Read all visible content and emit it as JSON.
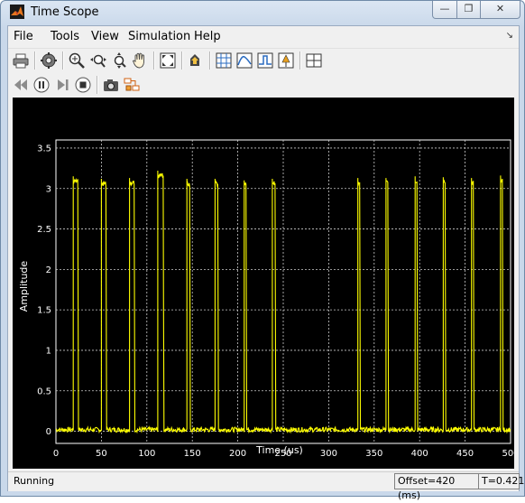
{
  "window": {
    "title": "Time Scope",
    "minimize_glyph": "—",
    "restore_glyph": "❐",
    "close_glyph": "✕"
  },
  "menu": {
    "items": [
      "File",
      "Tools",
      "View",
      "Simulation",
      "Help"
    ],
    "overflow_glyph": "↘"
  },
  "toolbar1": {
    "icons": [
      "print-icon",
      "settings-icon",
      "zoom-in-icon",
      "zoom-x-icon",
      "zoom-y-icon",
      "pan-hand-icon",
      "autoscale-icon",
      "restore-axes-icon",
      "data-cursors-icon",
      "peak-finder-icon",
      "bilevel-measurements-icon",
      "signal-statistics-icon",
      "layout-icon"
    ]
  },
  "toolbar2": {
    "icons": [
      "step-back-icon",
      "pause-icon",
      "step-forward-icon",
      "stop-icon",
      "snapshot-camera-icon",
      "highlight-block-icon"
    ]
  },
  "status": {
    "state": "Running",
    "offset": "Offset=420 (ms)",
    "time": "T=0.421"
  },
  "colors": {
    "plot_background": "#000000",
    "signal": "#ffff00",
    "grid": "#ffffff",
    "axes_text": "#ffffff"
  },
  "chart_data": {
    "type": "line",
    "title": "",
    "xlabel": "Time (us)",
    "ylabel": "Amplitude",
    "xlim": [
      0,
      500
    ],
    "ylim": [
      -0.15,
      3.6
    ],
    "xticks": [
      0,
      50,
      100,
      150,
      200,
      250,
      300,
      350,
      400,
      450,
      500
    ],
    "yticks": [
      0,
      0.5,
      1,
      1.5,
      2,
      2.5,
      3,
      3.5
    ],
    "grid": true,
    "legend": "none",
    "series": [
      {
        "color": "#ffff00",
        "pulses": [
          {
            "start": 19,
            "end": 24,
            "peak": 3.15
          },
          {
            "start": 50,
            "end": 55,
            "peak": 3.12
          },
          {
            "start": 81,
            "end": 86,
            "peak": 3.13
          },
          {
            "start": 112,
            "end": 118,
            "peak": 3.22
          },
          {
            "start": 144,
            "end": 147,
            "peak": 3.12
          },
          {
            "start": 175,
            "end": 178,
            "peak": 3.12
          },
          {
            "start": 207,
            "end": 209,
            "peak": 3.1
          },
          {
            "start": 238,
            "end": 241,
            "peak": 3.12
          },
          {
            "start": 332,
            "end": 334,
            "peak": 3.13
          },
          {
            "start": 363,
            "end": 365,
            "peak": 3.13
          },
          {
            "start": 395,
            "end": 397,
            "peak": 3.15
          },
          {
            "start": 426,
            "end": 428,
            "peak": 3.14
          },
          {
            "start": 457,
            "end": 459,
            "peak": 3.13
          },
          {
            "start": 489,
            "end": 491,
            "peak": 3.16
          }
        ],
        "baseline": 0.02
      }
    ]
  }
}
